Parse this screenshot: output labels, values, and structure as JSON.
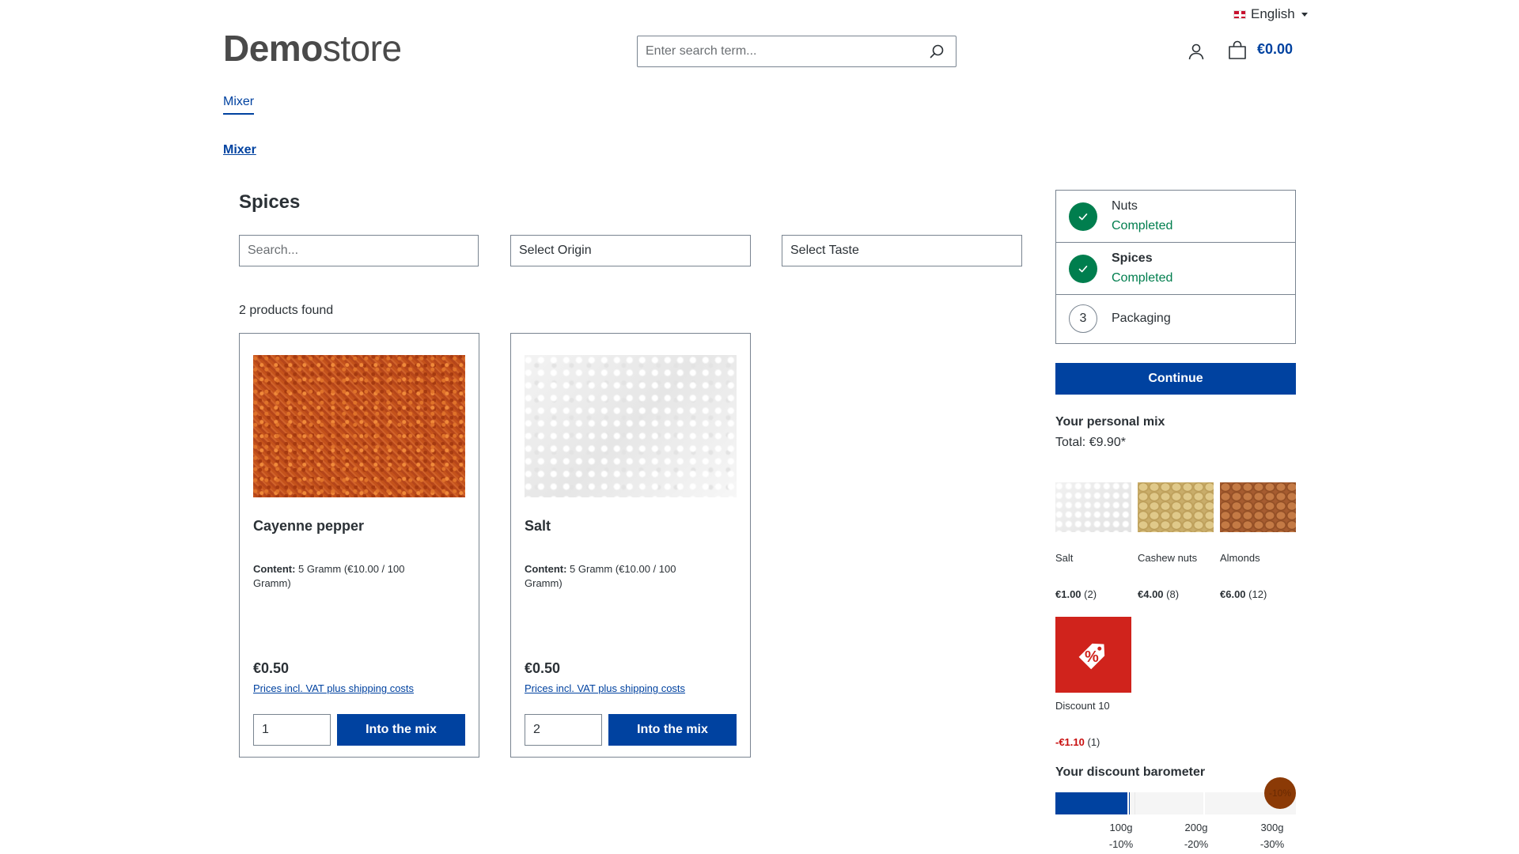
{
  "header": {
    "language": "English",
    "logo_bold": "Demo",
    "logo_light": "store",
    "search_placeholder": "Enter search term...",
    "cart_total": "€0.00"
  },
  "nav": {
    "main_item": "Mixer",
    "breadcrumb": "Mixer"
  },
  "listing": {
    "title": "Spices",
    "filter_search_placeholder": "Search...",
    "filter_origin": "Select Origin",
    "filter_taste": "Select Taste",
    "results_count": "2 products found"
  },
  "products": [
    {
      "name": "Cayenne pepper",
      "content_label": "Content:",
      "content_value": " 5 Gramm (€10.00 / 100 Gramm)",
      "price": "€0.50",
      "vat_link": "Prices incl. VAT plus shipping costs",
      "quantity": "1",
      "button": "Into the mix"
    },
    {
      "name": "Salt",
      "content_label": "Content:",
      "content_value": " 5 Gramm (€10.00 / 100 Gramm)",
      "price": "€0.50",
      "vat_link": "Prices incl. VAT plus shipping costs",
      "quantity": "2",
      "button": "Into the mix"
    }
  ],
  "steps": [
    {
      "title": "Nuts",
      "status": "Completed"
    },
    {
      "title": "Spices",
      "status": "Completed"
    },
    {
      "number": "3",
      "title": "Packaging"
    }
  ],
  "sidebar": {
    "continue_button": "Continue",
    "mix_title": "Your personal mix",
    "mix_total": "Total: €9.90*",
    "mix_items": [
      {
        "name": "Salt",
        "price": "€1.00",
        "qty": " (2)"
      },
      {
        "name": "Cashew nuts",
        "price": "€4.00",
        "qty": " (8)"
      },
      {
        "name": "Almonds",
        "price": "€6.00",
        "qty": " (12)"
      }
    ],
    "discount": {
      "name": "Discount 10",
      "price": "-€1.10",
      "qty": " (1)"
    },
    "barometer": {
      "title": "Your discount barometer",
      "badge": "-10%",
      "fill_fraction": 0.31,
      "levels": [
        {
          "weight": "100g",
          "discount": "-10%"
        },
        {
          "weight": "200g",
          "discount": "-20%"
        },
        {
          "weight": "300g",
          "discount": "-30%"
        }
      ]
    }
  },
  "colors": {
    "primary": "#0042a0",
    "success": "#007e4e",
    "discount": "#d0231c",
    "badge": "#8b3a06"
  }
}
